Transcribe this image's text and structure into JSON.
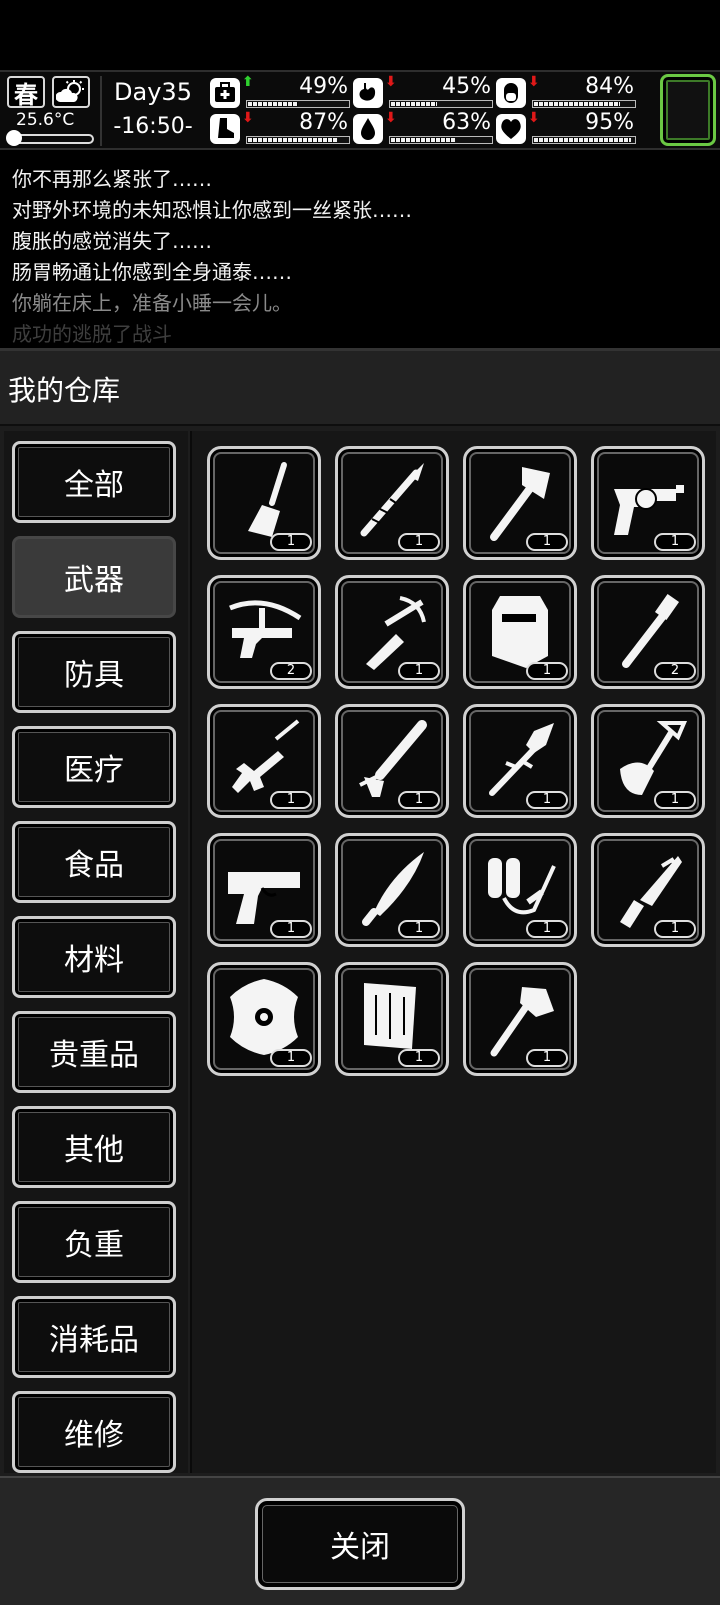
{
  "status": {
    "season": "春",
    "temperature": "25.6°C",
    "day": "Day35",
    "time": "-16:50-",
    "stats": [
      {
        "name": "health",
        "icon": "medkit-icon",
        "trend": "up",
        "percent": "49%",
        "value": 49
      },
      {
        "name": "hunger",
        "icon": "stomach-icon",
        "trend": "down",
        "percent": "45%",
        "value": 45
      },
      {
        "name": "pills",
        "icon": "pill-icon",
        "trend": "down",
        "percent": "84%",
        "value": 84
      },
      {
        "name": "stamina",
        "icon": "boot-icon",
        "trend": "down",
        "percent": "87%",
        "value": 87
      },
      {
        "name": "thirst",
        "icon": "water-drop-icon",
        "trend": "down",
        "percent": "63%",
        "value": 63
      },
      {
        "name": "mood",
        "icon": "heart-icon",
        "trend": "down",
        "percent": "95%",
        "value": 95
      }
    ]
  },
  "log": {
    "lines": [
      "你不再那么紧张了……",
      "对野外环境的未知恐惧让你感到一丝紧张……",
      "腹胀的感觉消失了……",
      "肠胃畅通让你感到全身通泰……",
      "你躺在床上，准备小睡一会儿。",
      "成功的逃脱了战斗"
    ]
  },
  "panel": {
    "title": "我的仓库",
    "categories": [
      "全部",
      "武器",
      "防具",
      "医疗",
      "食品",
      "材料",
      "贵重品",
      "其他",
      "负重",
      "消耗品",
      "维修"
    ],
    "active_category": "武器",
    "items": [
      {
        "name": "trowel",
        "icon": "trowel-icon",
        "qty": "1"
      },
      {
        "name": "spear",
        "icon": "spear-icon",
        "qty": "1"
      },
      {
        "name": "axe",
        "icon": "axe-icon",
        "qty": "1"
      },
      {
        "name": "revolver",
        "icon": "revolver-icon",
        "qty": "1"
      },
      {
        "name": "crossbow",
        "icon": "crossbow-icon",
        "qty": "2"
      },
      {
        "name": "hand crossbow",
        "icon": "hand-crossbow-icon",
        "qty": "1"
      },
      {
        "name": "riot shield",
        "icon": "riot-shield-icon",
        "qty": "1"
      },
      {
        "name": "pipe wrench",
        "icon": "pipe-wrench-icon",
        "qty": "2"
      },
      {
        "name": "submachine gun",
        "icon": "submachine-gun-icon",
        "qty": "1"
      },
      {
        "name": "caulking gun",
        "icon": "caulking-gun-icon",
        "qty": "1"
      },
      {
        "name": "spear tip",
        "icon": "spear-tip-icon",
        "qty": "1"
      },
      {
        "name": "shovel",
        "icon": "shovel-icon",
        "qty": "1"
      },
      {
        "name": "desert eagle",
        "icon": "pistol-icon",
        "qty": "1"
      },
      {
        "name": "machete",
        "icon": "machete-icon",
        "qty": "1"
      },
      {
        "name": "flamethrower",
        "icon": "flamethrower-icon",
        "qty": "1"
      },
      {
        "name": "combat knife",
        "icon": "combat-knife-icon",
        "qty": "1"
      },
      {
        "name": "round shield",
        "icon": "round-shield-icon",
        "qty": "1"
      },
      {
        "name": "wooden board",
        "icon": "wooden-board-icon",
        "qty": "1"
      },
      {
        "name": "fire axe",
        "icon": "fire-axe-icon",
        "qty": "1"
      }
    ],
    "close_label": "关闭"
  },
  "colors": {
    "trend_up": "#2fd22f",
    "trend_down": "#e01818",
    "slot_border": "#6bc844"
  }
}
